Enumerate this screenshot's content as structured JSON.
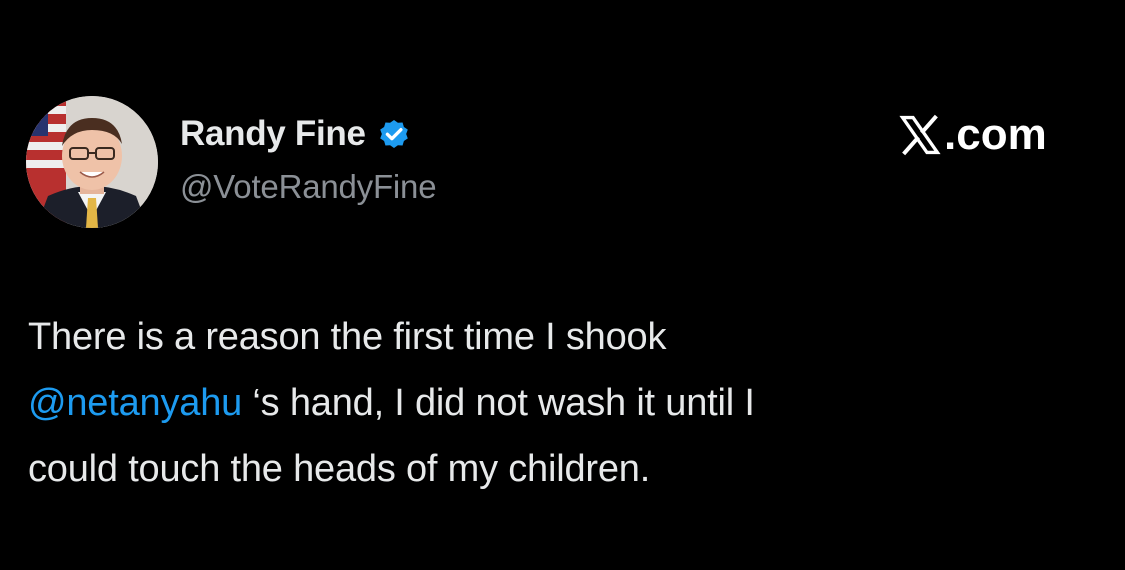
{
  "post": {
    "author": {
      "display_name": "Randy Fine",
      "handle": "@VoteRandyFine",
      "verified": true,
      "verified_badge_color": "#1d9bf0"
    },
    "brand": {
      "icon": "x-logo-icon",
      "suffix": ".com"
    },
    "text": {
      "line1": "There is a reason the first time I shook",
      "mention": "@netanyahu",
      "line2_rest": " ‘s hand, I did not wash it until I",
      "line3": "could touch the heads of my children."
    },
    "colors": {
      "background": "#000000",
      "text": "#e7e9ea",
      "secondary_text": "#8b9096",
      "link": "#1d9bf0"
    }
  }
}
